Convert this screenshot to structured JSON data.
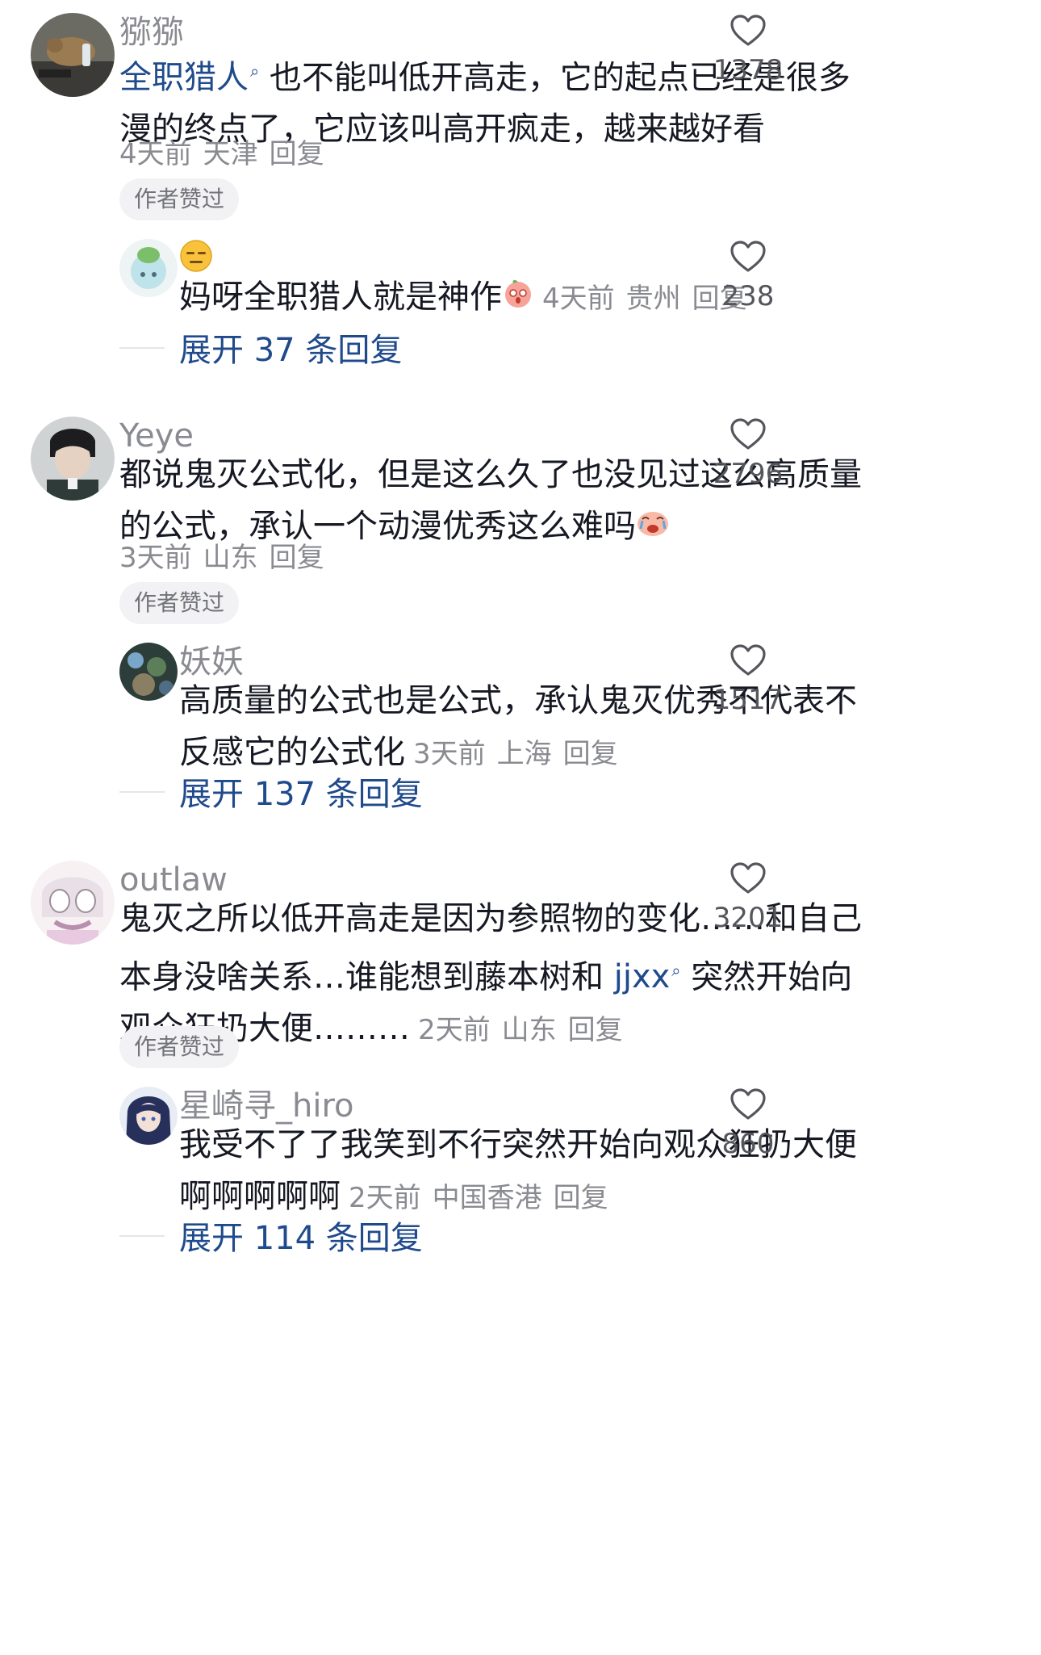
{
  "comments": [
    {
      "username": "猕猕",
      "mention": "全职猎人",
      "text_after_mention": " 也不能叫低开高走，它的起点已经是很多漫的终点了，它应该叫高开疯走，越来越好看",
      "time": "4天前",
      "location": "天津",
      "reply_label": "回复",
      "badge": "作者赞过",
      "likes": "1378",
      "reply": {
        "username": "",
        "text": "妈呀全职猎人就是神作",
        "time": "4天前",
        "location": "贵州",
        "reply_label": "回复",
        "likes": "238"
      },
      "expand": "展开 37 条回复"
    },
    {
      "username": "Yeye",
      "text": "都说鬼灭公式化，但是这么久了也没见过这么高质量的公式，承认一个动漫优秀这么难吗",
      "time": "3天前",
      "location": "山东",
      "reply_label": "回复",
      "badge": "作者赞过",
      "likes": "2796",
      "reply": {
        "username": "妖妖",
        "text": "高质量的公式也是公式，承认鬼灭优秀不代表不反感它的公式化",
        "time": "3天前",
        "location": "上海",
        "reply_label": "回复",
        "likes": "1517"
      },
      "expand": "展开 137 条回复"
    },
    {
      "username": "outlaw",
      "text_before_mention": "鬼灭之所以低开高走是因为参照物的变化……和自己本身没啥关系…谁能想到藤本树和 ",
      "mention": "jjxx",
      "text_after_mention": " 突然开始向观众狂扔大便………",
      "time": "2天前",
      "location": "山东",
      "reply_label": "回复",
      "badge": "作者赞过",
      "likes": "3201",
      "reply": {
        "username": "星崎寻_hiro",
        "text": "我受不了了我笑到不行突然开始向观众狂扔大便啊啊啊啊啊",
        "time": "2天前",
        "location": "中国香港",
        "reply_label": "回复",
        "likes": "860"
      },
      "expand": "展开 114 条回复"
    }
  ],
  "icons": {
    "like": "heart-outline-icon",
    "emoji_neutral": "expressionless-face-emoji",
    "emoji_shocked": "shocked-peach-emoji",
    "emoji_crying": "crying-face-emoji",
    "mention_search": "search-icon"
  },
  "colors": {
    "mention": "#1f4a8c",
    "secondary_text": "#8a8b91",
    "primary_text": "#161823",
    "badge_bg": "#f2f2f4"
  }
}
